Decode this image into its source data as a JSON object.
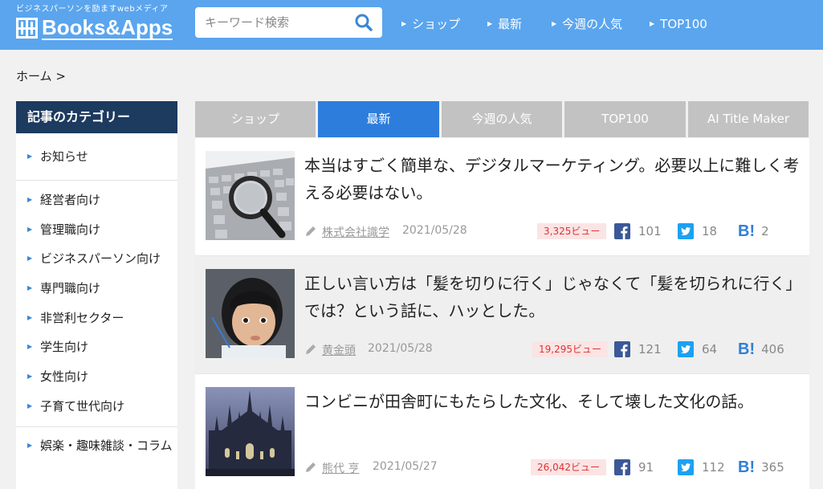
{
  "header": {
    "tagline": "ビジネスパーソンを励ますwebメディア",
    "logo_text": "Books&Apps",
    "search_placeholder": "キーワード検索",
    "nav": [
      {
        "label": "ショップ",
        "icon": "triangle-right-icon"
      },
      {
        "label": "最新",
        "icon": "triangle-right-icon"
      },
      {
        "label": "今週の人気",
        "icon": "triangle-right-icon"
      },
      {
        "label": "TOP100",
        "icon": "triangle-right-icon"
      }
    ]
  },
  "breadcrumb": "ホーム >",
  "sidebar": {
    "title": "記事のカテゴリー",
    "items": [
      {
        "label": "お知らせ"
      },
      {
        "label": "経営者向け"
      },
      {
        "label": "管理職向け"
      },
      {
        "label": "ビジネスパーソン向け"
      },
      {
        "label": "専門職向け"
      },
      {
        "label": "非営利セクター"
      },
      {
        "label": "学生向け"
      },
      {
        "label": "女性向け"
      },
      {
        "label": "子育て世代向け"
      },
      {
        "label": "娯楽・趣味雑談・コラム"
      }
    ]
  },
  "tabs": [
    {
      "label": "ショップ",
      "active": false
    },
    {
      "label": "最新",
      "active": true
    },
    {
      "label": "今週の人気",
      "active": false
    },
    {
      "label": "TOP100",
      "active": false
    },
    {
      "label": "AI Title Maker",
      "active": false
    }
  ],
  "articles": [
    {
      "title": "本当はすごく簡単な、デジタルマーケティング。必要以上に難しく考える必要はない。",
      "author": "株式会社識学",
      "date": "2021/05/28",
      "views": "3,325ビュー",
      "facebook": "101",
      "twitter": "18",
      "hatena": "2",
      "thumbnail_icon": "magnifier-keyboard-image"
    },
    {
      "title": "正しい言い方は「髪を切りに行く」じゃなくて「髪を切られに行く」では？という話に、ハッとした。",
      "author": "黄金頭",
      "date": "2021/05/28",
      "views": "19,295ビュー",
      "facebook": "121",
      "twitter": "64",
      "hatena": "406",
      "thumbnail_icon": "child-portrait-image"
    },
    {
      "title": "コンビニが田舎町にもたらした文化、そして壊した文化の話。",
      "author": "熊代 亨",
      "date": "2021/05/27",
      "views": "26,042ビュー",
      "facebook": "91",
      "twitter": "112",
      "hatena": "365",
      "thumbnail_icon": "cathedral-image"
    }
  ],
  "colors": {
    "header_bg": "#5aa5ee",
    "sidebar_title_bg": "#1d3a5f",
    "tab_active": "#2d7ddc",
    "tab_inactive": "#c2c2c2",
    "views_text": "#dd3333",
    "facebook": "#3b5998",
    "twitter": "#1da1f2",
    "hatena": "#2f7fd6"
  },
  "icons": {
    "hatena_label": "B!"
  }
}
